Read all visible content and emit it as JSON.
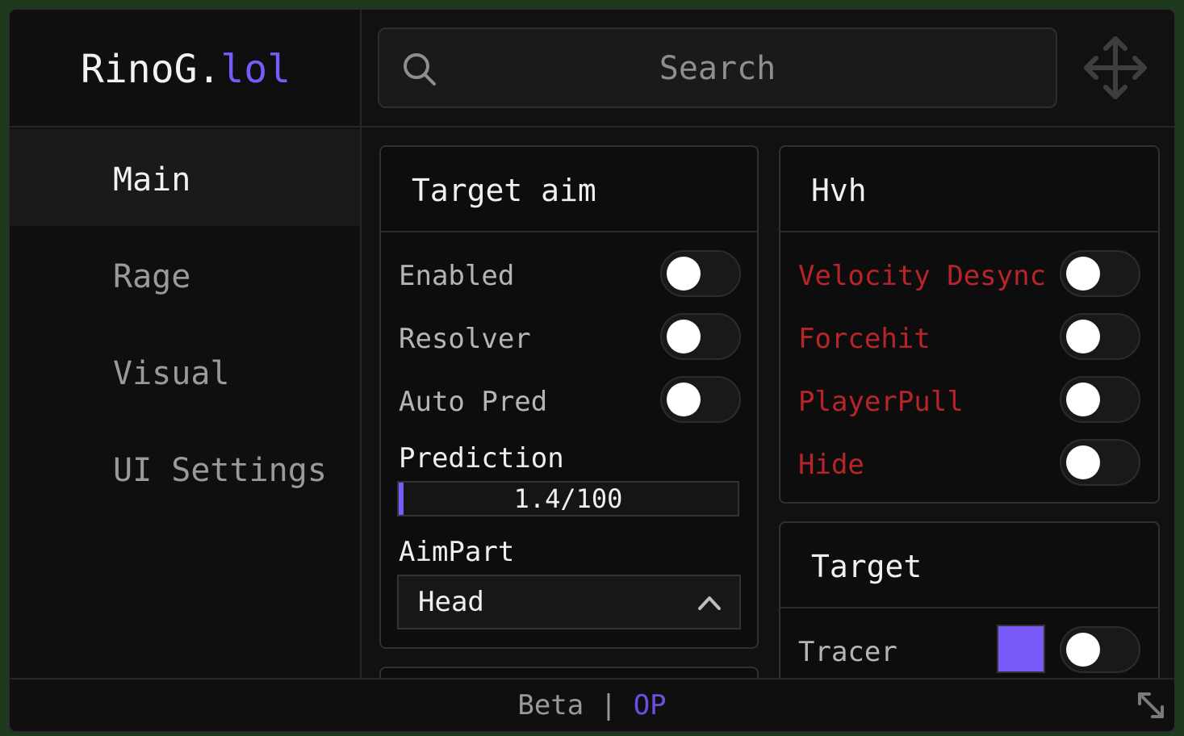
{
  "theme": {
    "accent": "#7a5af8",
    "accent_dim": "#6c4fe0",
    "danger": "#b8242a"
  },
  "logo": {
    "name": "RinoG.",
    "suffix": "lol"
  },
  "nav": {
    "items": [
      {
        "label": "Main",
        "active": true
      },
      {
        "label": "Rage",
        "active": false
      },
      {
        "label": "Visual",
        "active": false
      },
      {
        "label": "UI Settings",
        "active": false
      }
    ]
  },
  "search": {
    "placeholder": "Search",
    "icon": "search-icon"
  },
  "topbar": {
    "move_icon": "move-arrows-icon"
  },
  "target_aim": {
    "title": "Target aim",
    "toggles": [
      {
        "label": "Enabled",
        "on": false
      },
      {
        "label": "Resolver",
        "on": false
      },
      {
        "label": "Auto Pred",
        "on": false
      }
    ],
    "prediction": {
      "label": "Prediction",
      "value": 1.4,
      "max": 100,
      "display": "1.4/100"
    },
    "aimpart": {
      "label": "AimPart",
      "selected": "Head",
      "icon": "chevron-up-icon"
    }
  },
  "hvh": {
    "title": "Hvh",
    "toggles": [
      {
        "label": "Velocity Desync",
        "on": false
      },
      {
        "label": "Forcehit",
        "on": false
      },
      {
        "label": "PlayerPull",
        "on": false
      },
      {
        "label": "Hide",
        "on": false
      }
    ]
  },
  "target": {
    "title": "Target",
    "tracer": {
      "label": "Tracer",
      "color": "#7a5af8",
      "on": false
    }
  },
  "footer": {
    "left": "Beta",
    "sep": "|",
    "right": "OP",
    "resize_icon": "resize-diagonal-icon"
  }
}
